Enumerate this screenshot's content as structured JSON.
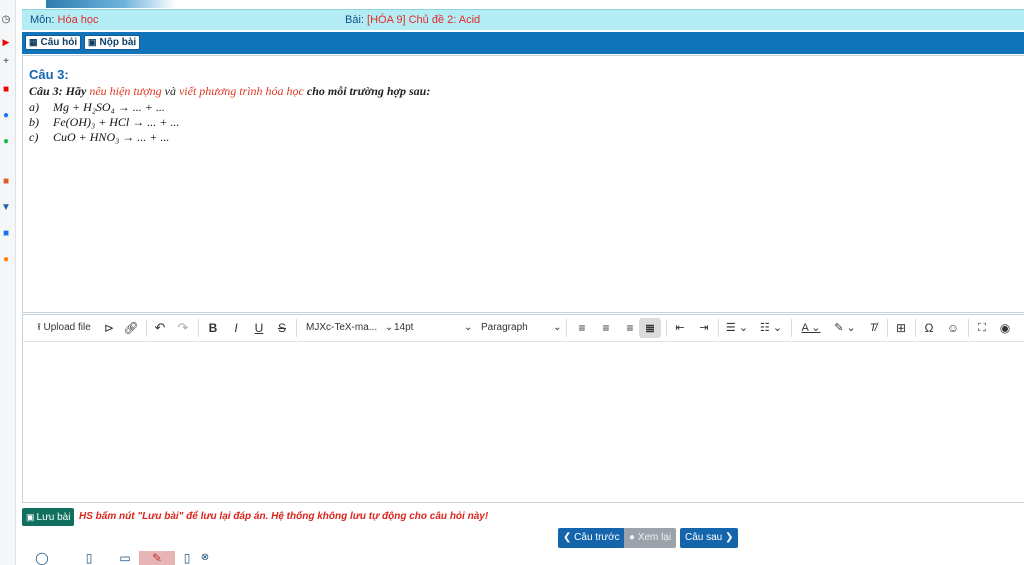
{
  "header": {
    "subject_label": "Môn:",
    "subject_value": "Hóa học",
    "lesson_label": "Bài:",
    "lesson_value": "[HÓA 9] Chủ đề 2: Acid"
  },
  "toolbar": {
    "questions_label": "Câu hỏi",
    "submit_label": "Nộp bài"
  },
  "question": {
    "title": "Câu 3:",
    "prefix": "Câu 3: Hãy",
    "highlight1": "nêu hiện tượng",
    "connector": "và",
    "highlight2": "viết phương trình hóa học",
    "suffix": "cho mỗi trường hợp sau:",
    "items": [
      {
        "label": "a)",
        "formula": "Mg  +  H₂SO₄ →  ...  +  ..."
      },
      {
        "label": "b)",
        "formula": "Fe(OH)₃  +  HCl  →  ...  +  ..."
      },
      {
        "label": "c)",
        "formula": "CuO  +  HNO₃  →  ...  +  ..."
      }
    ]
  },
  "editor": {
    "upload_label": "Upload file",
    "font_family": "MJXc-TeX-ma...",
    "font_size": "14pt",
    "block_format": "Paragraph"
  },
  "footer": {
    "save_label": "Lưu bài",
    "save_note": "HS bấm nút \"Lưu bài\" để lưu lại đáp án. Hệ thống không lưu tự động cho câu hỏi này!",
    "prev_label": "Câu trước",
    "review_label": "Xem lại",
    "next_label": "Câu sau"
  },
  "colors": {
    "primary": "#1173ba",
    "subject_bar": "#b4ecf3",
    "highlight": "#e0351f",
    "save": "#11705d"
  }
}
